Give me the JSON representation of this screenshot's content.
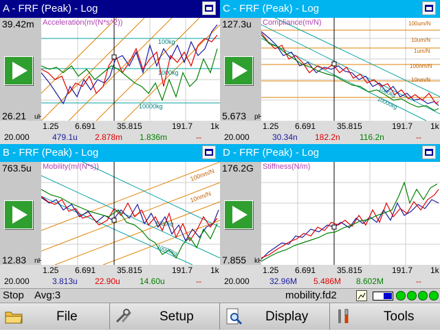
{
  "panes": [
    {
      "id": "A",
      "title": "A - FRF (Peak) - Log",
      "title_style": "dark",
      "y_max": "39.42m",
      "y_min": "26.21",
      "y_unit": "uHz",
      "plot_label": "Acceleration(m/(N*s^2))",
      "x_ticks": [
        "1.25",
        "6.691",
        "35.815",
        "191.7",
        "1k"
      ],
      "readout": {
        "freq": "20.000",
        "v1": "479.1u",
        "v2": "2.878m",
        "v3": "1.836m",
        "v4": "--"
      },
      "guide_labels": [
        "1000kg",
        "100kg",
        "10000kg"
      ]
    },
    {
      "id": "C",
      "title": "C - FRF (Peak) - Log",
      "title_style": "light",
      "y_max": "127.3u",
      "y_min": "5.673",
      "y_unit": "pHz",
      "plot_label": "Compliance(m/N)",
      "x_ticks": [
        "1.25",
        "6.691",
        "35.815",
        "191.7",
        "1k"
      ],
      "readout": {
        "freq": "20.000",
        "v1": "30.34n",
        "v2": "182.2n",
        "v3": "116.2n",
        "v4": "--"
      },
      "guide_labels": [
        "100um/N",
        "10um/N",
        "1um/N",
        "100nm/N",
        "10nm/N",
        "1000kg",
        "10000kg"
      ]
    },
    {
      "id": "B",
      "title": "B - FRF (Peak) - Log",
      "title_style": "light",
      "y_max": "763.5u",
      "y_min": "12.83",
      "y_unit": "nHz",
      "plot_label": "Mobility(m/(N*s))",
      "x_ticks": [
        "1.25",
        "6.691",
        "35.815",
        "191.7",
        "1k"
      ],
      "readout": {
        "freq": "20.000",
        "v1": "3.813u",
        "v2": "22.90u",
        "v3": "14.60u",
        "v4": "--"
      },
      "guide_labels": [
        "100nm/N",
        "10nm/N",
        "1000kg",
        "10000kg"
      ]
    },
    {
      "id": "D",
      "title": "D - FRF (Peak) - Log",
      "title_style": "light",
      "y_max": "176.2G",
      "y_min": "7.855",
      "y_unit": "kHz",
      "plot_label": "Stiffness(N/m)",
      "x_ticks": [
        "1.25",
        "6.691",
        "35.815",
        "191.7",
        "1k"
      ],
      "readout": {
        "freq": "20.000",
        "v1": "32.96M",
        "v2": "5.486M",
        "v3": "8.602M",
        "v4": "--"
      },
      "guide_labels": []
    }
  ],
  "status": {
    "state": "Stop",
    "avg": "Avg:3",
    "filename": "mobility.fd2"
  },
  "toolbar": {
    "file": "File",
    "setup": "Setup",
    "display": "Display",
    "tools": "Tools"
  },
  "colors": {
    "series1": "#1a1aa0",
    "series2": "#e00000",
    "series3": "#008000",
    "guide_orange": "#e08000",
    "guide_teal": "#00a0a0"
  }
}
